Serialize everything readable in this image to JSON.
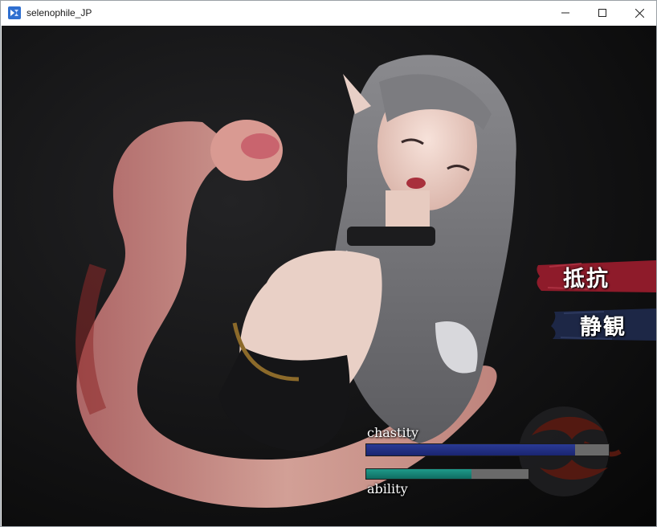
{
  "window": {
    "title": "selenophile_JP",
    "icons": {
      "app": "app-logo-icon",
      "minimize": "minimize-icon",
      "maximize": "maximize-icon",
      "close": "close-icon"
    }
  },
  "choices": [
    {
      "label": "抵抗",
      "color": "#8e1b2a"
    },
    {
      "label": "静観",
      "color": "#1d2746"
    }
  ],
  "status": {
    "chastity": {
      "label": "chastity",
      "value": 0.86,
      "color": "#23307f"
    },
    "ability": {
      "label": "ability",
      "value": 0.65,
      "color": "#178478"
    }
  },
  "colors": {
    "background": "#0b0b0c",
    "emblem": "#5a1a10"
  }
}
